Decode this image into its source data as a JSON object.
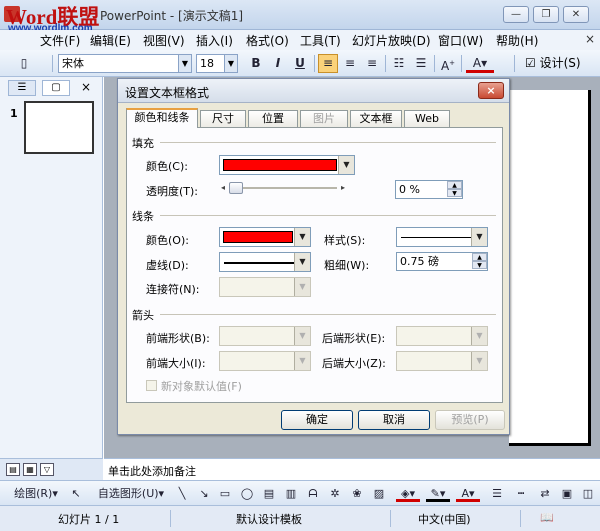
{
  "window": {
    "title": "Microsoft PowerPoint - [演示文稿1]",
    "title_visible": "PowerPoint - [演示文稿1]",
    "logo_text": "Word联盟",
    "logo_url": "www.wordlm.com",
    "controls": {
      "minimize": "—",
      "restore": "❐",
      "close": "✕"
    }
  },
  "menubar": {
    "items": [
      "文件(F)",
      "编辑(E)",
      "视图(V)",
      "插入(I)",
      "格式(O)",
      "工具(T)",
      "幻灯片放映(D)",
      "窗口(W)",
      "帮助(H)"
    ],
    "close_glyph": "×"
  },
  "toolbar": {
    "font_name": "宋体",
    "font_size": "18",
    "bold": "B",
    "italic": "I",
    "underline": "U",
    "design_label": "设计(S)"
  },
  "left_panel": {
    "tab_outline": "☰",
    "tab_slides": "▢",
    "close_glyph": "×",
    "slide_number": "1"
  },
  "dialog": {
    "title": "设置文本框格式",
    "close": "×",
    "tabs": [
      "颜色和线条",
      "尺寸",
      "位置",
      "图片",
      "文本框",
      "Web"
    ],
    "fill": {
      "section": "填充",
      "color_label": "颜色(C):",
      "color_value": "#ff0000",
      "transparency_label": "透明度(T):",
      "transparency_value": "0 %",
      "transparency_fraction": 0
    },
    "line": {
      "section": "线条",
      "color_label": "颜色(O):",
      "color_value": "#ff0000",
      "style_label": "样式(S):",
      "dashed_label": "虚线(D):",
      "weight_label": "粗细(W):",
      "weight_value": "0.75 磅",
      "connector_label": "连接符(N):"
    },
    "arrows": {
      "section": "箭头",
      "begin_style_label": "前端形状(B):",
      "end_style_label": "后端形状(E):",
      "begin_size_label": "前端大小(I):",
      "end_size_label": "后端大小(Z):"
    },
    "default_checkbox": "新对象默认值(F)",
    "buttons": {
      "ok": "确定",
      "cancel": "取消",
      "preview": "预览(P)"
    }
  },
  "notes": {
    "placeholder": "单击此处添加备注"
  },
  "drawing_toolbar": {
    "draw_label": "绘图(R)",
    "autoshapes_label": "自选图形(U)"
  },
  "statusbar": {
    "slide_info": "幻灯片 1 / 1",
    "template": "默认设计模板",
    "language": "中文(中国)"
  }
}
